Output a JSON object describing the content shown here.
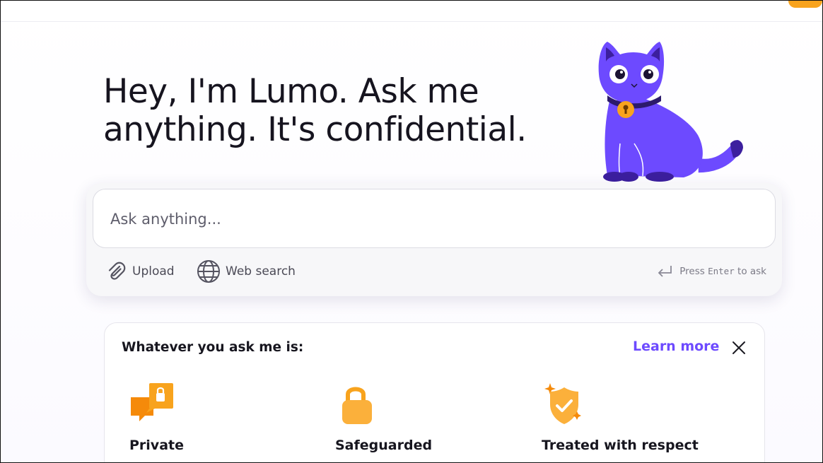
{
  "hero": {
    "line1": "Hey, I'm Lumo. Ask me",
    "line2": "anything. It's confidential."
  },
  "composer": {
    "placeholder": "Ask anything...",
    "upload_label": "Upload",
    "web_search_label": "Web search",
    "hint_press": "Press",
    "hint_key": "Enter",
    "hint_suffix": "to ask"
  },
  "info_card": {
    "title": "Whatever you ask me is:",
    "learn_more": "Learn more",
    "features": [
      {
        "label": "Private",
        "icon": "private-chat-lock-icon"
      },
      {
        "label": "Safeguarded",
        "icon": "padlock-icon"
      },
      {
        "label": "Treated with respect",
        "icon": "shield-check-icon"
      }
    ]
  },
  "colors": {
    "accent": "#6d4aff",
    "orange": "#f8a31d",
    "cat": "#6d4aff"
  }
}
